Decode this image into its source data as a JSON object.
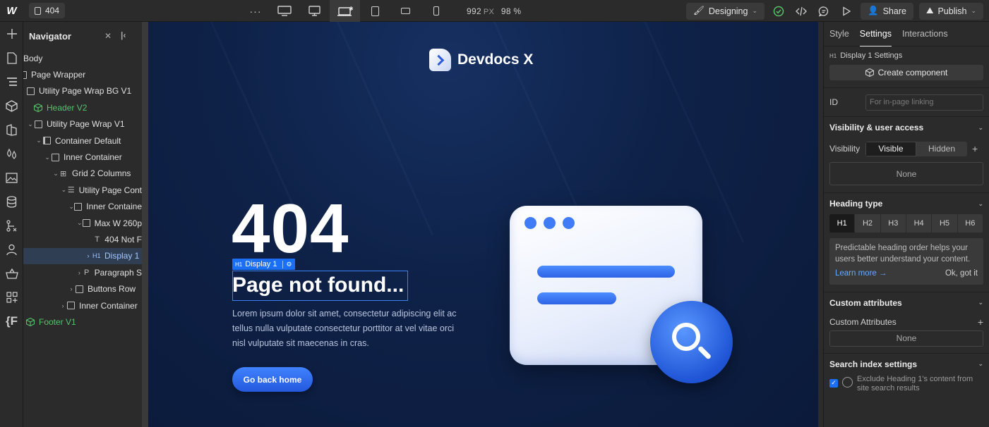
{
  "topbar": {
    "logo": "W",
    "page_name": "404",
    "more": "···",
    "width_value": "992",
    "width_unit": "PX",
    "zoom": "98 %",
    "mode_label": "Designing",
    "share_label": "Share",
    "publish_label": "Publish"
  },
  "navigator": {
    "title": "Navigator",
    "items": [
      {
        "label": "Body"
      },
      {
        "label": "Page Wrapper"
      },
      {
        "label": "Utility Page Wrap BG V1"
      },
      {
        "label": "Header V2"
      },
      {
        "label": "Utility Page Wrap V1"
      },
      {
        "label": "Container Default"
      },
      {
        "label": "Inner Container"
      },
      {
        "label": "Grid 2 Columns"
      },
      {
        "label": "Utility Page Cont"
      },
      {
        "label": "Inner Containe"
      },
      {
        "label": "Max W 260p"
      },
      {
        "label": "404 Not F"
      },
      {
        "label": "Display 1"
      },
      {
        "label": "Paragraph S"
      },
      {
        "label": "Buttons Row"
      },
      {
        "label": "Inner Container"
      },
      {
        "label": "Footer V1"
      }
    ]
  },
  "canvas": {
    "brand_name": "Devdocs X",
    "big_number": "404",
    "selection_tag": "Display 1",
    "selection_h": "H1",
    "heading": "Page not found...",
    "paragraph": "Lorem ipsum dolor sit amet, consectetur adipiscing elit ac tellus nulla vulputate consectetur porttitor at vel vitae orci nisl vulputate sit maecenas in cras.",
    "cta_label": "Go back home"
  },
  "panel": {
    "tabs": [
      "Style",
      "Settings",
      "Interactions"
    ],
    "settings_title": "Display 1 Settings",
    "settings_h": "H1",
    "create_component": "Create component",
    "id_label": "ID",
    "id_placeholder": "For in-page linking",
    "visibility_section": "Visibility & user access",
    "visibility_label": "Visibility",
    "visible": "Visible",
    "hidden": "Hidden",
    "visibility_none": "None",
    "heading_type_section": "Heading type",
    "heading_types": [
      "H1",
      "H2",
      "H3",
      "H4",
      "H5",
      "H6"
    ],
    "tip_text": "Predictable heading order helps your users better understand your content.",
    "learn_more": "Learn more →",
    "ok_got_it": "Ok, got it",
    "custom_attr_section": "Custom attributes",
    "custom_attr_label": "Custom Attributes",
    "custom_attr_none": "None",
    "search_section": "Search index settings",
    "exclude_text": "Exclude Heading 1's content from site search results"
  },
  "colors": {
    "accent": "#1a6ff5",
    "component_green": "#57c26b",
    "canvas_bg": "#0e2147"
  }
}
